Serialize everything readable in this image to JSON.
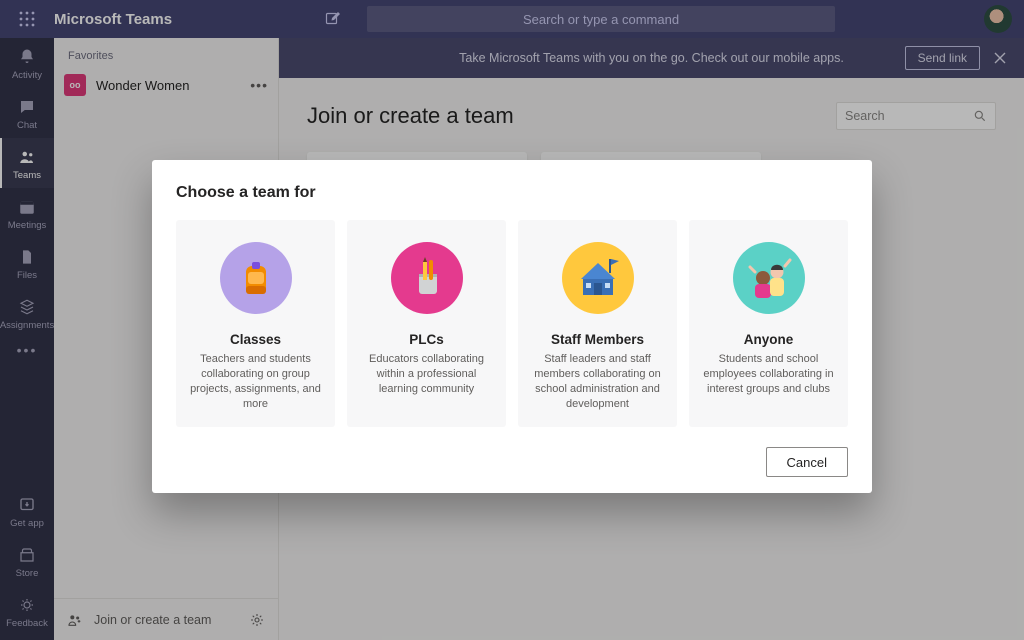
{
  "brand": "Microsoft Teams",
  "top_search_placeholder": "Search or type a command",
  "rail": {
    "activity": "Activity",
    "chat": "Chat",
    "teams": "Teams",
    "meetings": "Meetings",
    "files": "Files",
    "assignments": "Assignments",
    "get_app": "Get app",
    "store": "Store",
    "feedback": "Feedback"
  },
  "teams_panel": {
    "favorites_label": "Favorites",
    "team_name": "Wonder Women",
    "team_initials": "oo",
    "join_create": "Join or create a team"
  },
  "banner": {
    "text": "Take Microsoft Teams with you on the go. Check out our mobile apps.",
    "send_link": "Send link"
  },
  "page": {
    "title": "Join or create a team",
    "search_placeholder": "Search"
  },
  "dialog": {
    "title": "Choose a team for",
    "cancel": "Cancel",
    "cards": [
      {
        "title": "Classes",
        "desc": "Teachers and students collaborating on group projects, assignments, and more"
      },
      {
        "title": "PLCs",
        "desc": "Educators collaborating within a professional learning community"
      },
      {
        "title": "Staff Members",
        "desc": "Staff leaders and staff members collaborating on school administration and development"
      },
      {
        "title": "Anyone",
        "desc": "Students and school employees collaborating in interest groups and clubs"
      }
    ]
  },
  "colors": {
    "classes_bg": "#b5a2e8",
    "plc_bg": "#e43a8e",
    "staff_bg": "#ffc83d",
    "anyone_bg": "#5bd1c6"
  }
}
